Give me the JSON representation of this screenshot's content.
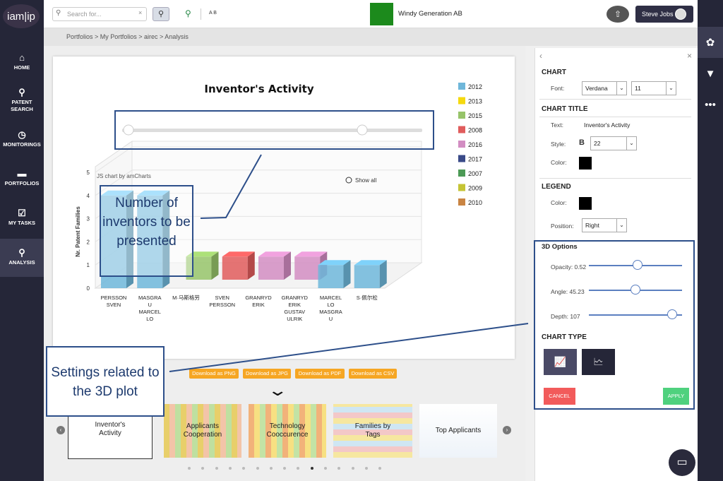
{
  "nav": {
    "logo": "iam|ip",
    "items": [
      {
        "label": "HOME",
        "icon": "⌂"
      },
      {
        "label": "PATENT SEARCH",
        "icon": "⚲"
      },
      {
        "label": "MONITORINGS",
        "icon": "◷"
      },
      {
        "label": "PORTFOLIOS",
        "icon": "▬"
      },
      {
        "label": "MY TASKS",
        "icon": "☑"
      },
      {
        "label": "ANALYSIS",
        "icon": "⚲"
      }
    ]
  },
  "topbar": {
    "search_placeholder": "Search for...",
    "company": "Windy Generation AB",
    "user": "Steve Jobs",
    "brand_color": "#1c8a1c",
    "ab_label": "A B"
  },
  "breadcrumb": "Portfolios > My Portfolios > airec > Analysis",
  "chart_data": {
    "type": "bar",
    "title": "Inventor's Activity",
    "ylabel": "Nr. Patent Families",
    "ylim": [
      0,
      5
    ],
    "yticks": [
      "0",
      "1",
      "2",
      "3",
      "4",
      "5"
    ],
    "categories": [
      "PERSSON SVEN",
      "MASGRAU MARCELLO",
      "M·马斯格劳",
      "SVEN PERSSON",
      "GRANRYD ERIK",
      "GRANRYD ERIK GUSTAV ULRIK",
      "MARCELLO MASGRAU",
      "S·佩尔松"
    ],
    "category_lines": [
      [
        "PERSSON",
        "SVEN"
      ],
      [
        "MASGRA",
        "U",
        "MARCEL",
        "LO"
      ],
      [
        "M·马斯格劳"
      ],
      [
        "SVEN",
        "PERSSON"
      ],
      [
        "GRANRYD",
        "ERIK"
      ],
      [
        "GRANRYD",
        "ERIK",
        "GUSTAV",
        "ULRIK"
      ],
      [
        "MARCEL",
        "LO",
        "MASGRA",
        "U"
      ],
      [
        "S·佩尔松"
      ]
    ],
    "legend": [
      {
        "name": "2012",
        "color": "#6fb7da"
      },
      {
        "name": "2013",
        "color": "#f5d90f"
      },
      {
        "name": "2015",
        "color": "#97c46a"
      },
      {
        "name": "2008",
        "color": "#e05c5c"
      },
      {
        "name": "2016",
        "color": "#d28dc2"
      },
      {
        "name": "2017",
        "color": "#3a4a88"
      },
      {
        "name": "2007",
        "color": "#4c9a56"
      },
      {
        "name": "2009",
        "color": "#c5c435"
      },
      {
        "name": "2010",
        "color": "#c98443"
      }
    ],
    "bars": [
      {
        "cat": 0,
        "value": 4,
        "color": "#6fb7da"
      },
      {
        "cat": 1,
        "value": 4,
        "color": "#6fb7da"
      },
      {
        "cat": 2,
        "value": 1,
        "color": "#97c46a"
      },
      {
        "cat": 3,
        "value": 1,
        "color": "#e05c5c"
      },
      {
        "cat": 4,
        "value": 1,
        "color": "#d28dc2"
      },
      {
        "cat": 5,
        "value": 1,
        "color": "#d28dc2"
      },
      {
        "cat": 6,
        "value": 1,
        "color": "#6fb7da"
      },
      {
        "cat": 7,
        "value": 1,
        "color": "#6fb7da"
      }
    ],
    "credit": "JS chart by amCharts",
    "show_all": "Show all"
  },
  "downloads": [
    "Download as PNG",
    "Download as JPG",
    "Download as PDF",
    "Download as CSV"
  ],
  "thumbs": [
    "Inventor's Activity",
    "Applicants Cooperation",
    "Technology Cooccurence",
    "Families by Tags",
    "Top Applicants"
  ],
  "panel": {
    "chart_h": "CHART",
    "font_l": "Font:",
    "font": "Verdana",
    "size": "11",
    "title_h": "CHART TITLE",
    "text_l": "Text:",
    "text": "Inventor's Activity",
    "style_l": "Style:",
    "bold": "B",
    "title_size": "22",
    "color_l": "Color:",
    "legend_h": "LEGEND",
    "lcolor_l": "Color:",
    "pos_l": "Position:",
    "pos": "Right",
    "d3_h": "3D Options",
    "opacity": "Opacity: 0.52",
    "angle": "Angle: 45.23",
    "depth": "Depth: 107",
    "type_h": "CHART TYPE",
    "cancel": "CANCEL",
    "apply": "APPLY",
    "opacity_val": 0.52,
    "angle_val": 45.23,
    "depth_val": 107
  },
  "callouts": {
    "inventors": "Number of inventors to be presented",
    "settings": "Settings related to the 3D plot"
  }
}
